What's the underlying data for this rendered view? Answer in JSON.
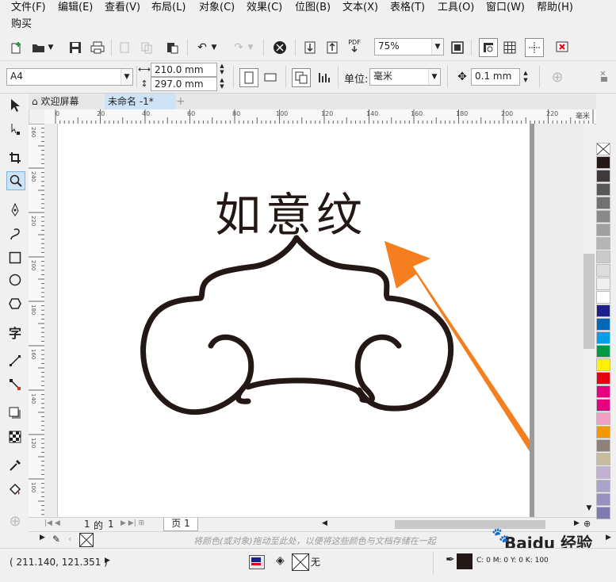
{
  "menu": {
    "items": [
      "文件(F)",
      "编辑(E)",
      "查看(V)",
      "布局(L)",
      "对象(C)",
      "效果(C)",
      "位图(B)",
      "文本(X)",
      "表格(T)",
      "工具(O)",
      "窗口(W)",
      "帮助(H)"
    ],
    "second_row": "购买"
  },
  "toolbar": {
    "zoom_value": "75%",
    "pdf_label": "PDF",
    "page_size": "A4",
    "width": "210.0 mm",
    "height": "297.0 mm",
    "units_label": "单位:",
    "units_value": "毫米",
    "nudge_value": "0.1 mm"
  },
  "tabs": {
    "welcome": "欢迎屏幕",
    "document": "未命名 -1*"
  },
  "ruler": {
    "h_ticks": [
      "0",
      "20",
      "40",
      "60",
      "80",
      "100",
      "120",
      "140",
      "160",
      "180",
      "200",
      "220"
    ],
    "unit": "毫米",
    "v_ticks": [
      "260",
      "240",
      "220",
      "200",
      "180",
      "160",
      "140",
      "120",
      "100"
    ]
  },
  "canvas": {
    "title_text": "如意纹"
  },
  "page_nav": {
    "current": "1",
    "of": "的",
    "total": "1",
    "page_tab": "页 1"
  },
  "colorbar": {
    "hint": "将颜色(或对象)拖动至此处，以便将这些颜色与文档存储在一起"
  },
  "status": {
    "coords": "( 211.140, 121.351 )",
    "fill_label": "无",
    "outline_info": "C: 0 M: 0 Y: 0 K: 100"
  },
  "watermark": "Baidu 经验",
  "colors": {
    "arrow": "#f57f1f",
    "stroke": "#231815",
    "accent_selected": "#cfe3f7"
  },
  "palette": [
    "#ffffff",
    "#231815",
    "#3d3a39",
    "#595757",
    "#727171",
    "#898989",
    "#9fa0a0",
    "#b5b5b6",
    "#c9caca",
    "#dcdddd",
    "#efefef",
    "#ffffff",
    "#1d2088",
    "#0068b7",
    "#00a0e9",
    "#009944",
    "#fff100",
    "#e60012",
    "#e4007f",
    "#e5007f",
    "#f19ec2",
    "#f39800",
    "#8f8178",
    "#c9bc9c",
    "#c3b0d6",
    "#aaa4cc",
    "#9a8fc1",
    "#7f7ab0"
  ]
}
